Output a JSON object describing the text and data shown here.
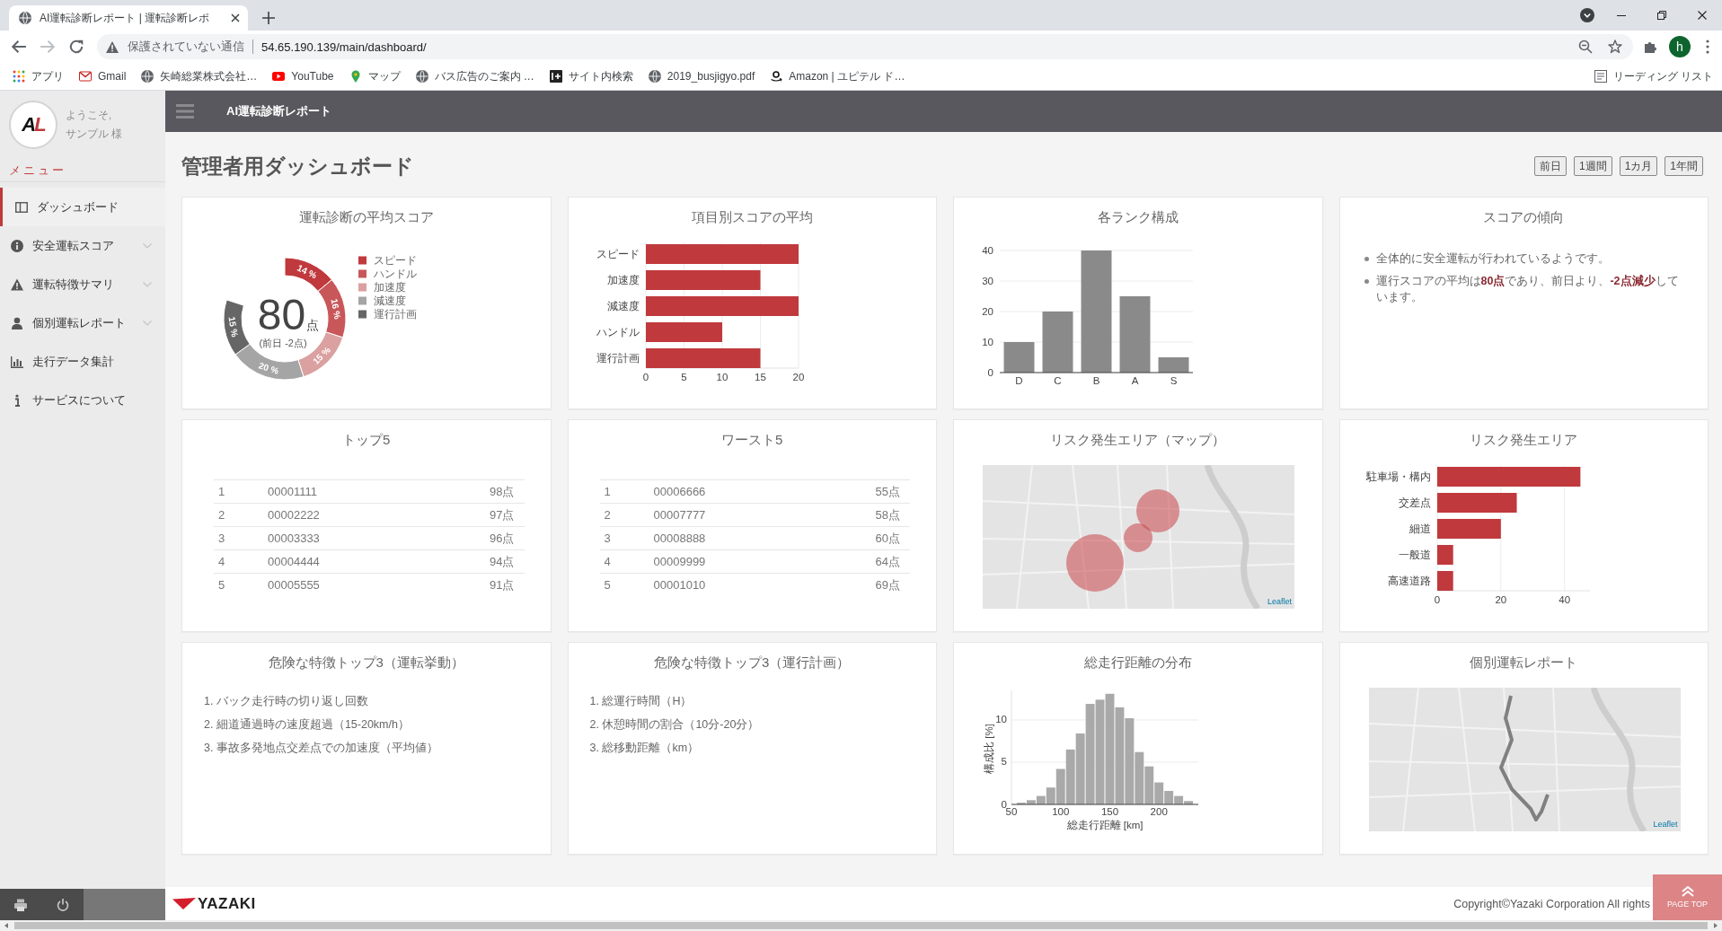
{
  "browser": {
    "tab": {
      "title": "AI運転診断レポート | 運転診断レポ"
    },
    "address": {
      "security": "保護されていない通信",
      "url": "54.65.190.139/main/dashboard/"
    },
    "profile_initial": "h",
    "bookmarks": [
      {
        "kind": "apps",
        "label": "アプリ"
      },
      {
        "kind": "mail",
        "label": "Gmail"
      },
      {
        "kind": "globe",
        "label": "矢崎総業株式会社…"
      },
      {
        "kind": "video",
        "label": "YouTube"
      },
      {
        "kind": "pin",
        "label": "マップ"
      },
      {
        "kind": "globe",
        "label": "バス広告のご案内 …"
      },
      {
        "kind": "site",
        "label": "サイト内検索"
      },
      {
        "kind": "globe",
        "label": "2019_busjigyo.pdf"
      },
      {
        "kind": "shop",
        "label": "Amazon | ユピテル ド…"
      }
    ],
    "reading_list": "リーディング リスト"
  },
  "sidebar": {
    "logo_text": "AL",
    "welcome": "ようこそ,",
    "user": "サンプル 様",
    "menu_heading": "メニュー",
    "items": [
      {
        "kind": "panel",
        "label": "ダッシュボード",
        "selected": true,
        "expandable": false
      },
      {
        "kind": "info",
        "label": "安全運転スコア",
        "selected": false,
        "expandable": true
      },
      {
        "kind": "warning",
        "label": "運転特徴サマリ",
        "selected": false,
        "expandable": true
      },
      {
        "kind": "user",
        "label": "個別運転レポート",
        "selected": false,
        "expandable": true
      },
      {
        "kind": "chart",
        "label": "走行データ集計",
        "selected": false,
        "expandable": false
      },
      {
        "kind": "about",
        "label": "サービスについて",
        "selected": false,
        "expandable": false
      }
    ]
  },
  "header": {
    "title": "AI運転診断レポート"
  },
  "page": {
    "title": "管理者用ダッシュボード",
    "period_buttons": [
      "前日",
      "1週間",
      "1カ月",
      "1年間"
    ]
  },
  "cards": [
    {
      "kind": "chart",
      "title": "運転診断の平均スコア",
      "score": "80",
      "unit": "点",
      "change": "(前日 -2点)",
      "chart_data": {
        "type": "donut",
        "categories": [
          "スピード",
          "ハンドル",
          "加速度",
          "減速度",
          "運行計画"
        ],
        "values": [
          14,
          16,
          15,
          20,
          15
        ],
        "colors": [
          "#c0393d",
          "#c8575a",
          "#dba0a0",
          "#a5a5a5",
          "#666666"
        ],
        "value_labels": [
          "14 %",
          "16 %",
          "15 %",
          "20 %",
          "15 %"
        ],
        "legend": "right"
      }
    },
    {
      "kind": "chart",
      "title": "項目別スコアの平均",
      "chart_data": {
        "type": "bar",
        "orientation": "horizontal",
        "categories": [
          "スピード",
          "加速度",
          "減速度",
          "ハンドル",
          "運行計画"
        ],
        "values": [
          20,
          15,
          20,
          10,
          15
        ],
        "xlim": [
          0,
          20
        ],
        "xticks": [
          0,
          5,
          10,
          15,
          20
        ],
        "grid": true
      }
    },
    {
      "kind": "chart",
      "title": "各ランク構成",
      "chart_data": {
        "type": "bar",
        "orientation": "vertical",
        "categories": [
          "D",
          "C",
          "B",
          "A",
          "S"
        ],
        "values": [
          10,
          20,
          40,
          25,
          5
        ],
        "ylim": [
          0,
          40
        ],
        "yticks": [
          0,
          10,
          20,
          30,
          40
        ],
        "grid": true
      }
    },
    {
      "kind": "notes",
      "title": "スコアの傾向",
      "bullets": [
        "全体的に安全運転が行われているようです。",
        "運行スコアの平均は**80点**であり、前日より、**-2点減少**しています。"
      ]
    },
    {
      "kind": "ranking",
      "title": "トップ5",
      "rows": [
        {
          "rank": "1",
          "id": "00001111",
          "score": "98点"
        },
        {
          "rank": "2",
          "id": "00002222",
          "score": "97点"
        },
        {
          "rank": "3",
          "id": "00003333",
          "score": "96点"
        },
        {
          "rank": "4",
          "id": "00004444",
          "score": "94点"
        },
        {
          "rank": "5",
          "id": "00005555",
          "score": "91点"
        }
      ]
    },
    {
      "kind": "ranking",
      "title": "ワースト5",
      "rows": [
        {
          "rank": "1",
          "id": "00006666",
          "score": "55点"
        },
        {
          "rank": "2",
          "id": "00007777",
          "score": "58点"
        },
        {
          "rank": "3",
          "id": "00008888",
          "score": "60点"
        },
        {
          "rank": "4",
          "id": "00009999",
          "score": "64点"
        },
        {
          "rank": "5",
          "id": "00001010",
          "score": "69点"
        }
      ]
    },
    {
      "kind": "risk_map",
      "title": "リスク発生エリア（マップ）",
      "attribution": "Leaflet"
    },
    {
      "kind": "chart",
      "title": "リスク発生エリア",
      "chart_data": {
        "type": "bar",
        "orientation": "horizontal",
        "categories": [
          "駐車場・構内",
          "交差点",
          "細道",
          "一般道",
          "高速道路"
        ],
        "values": [
          45,
          25,
          20,
          5,
          5
        ],
        "xlim": [
          0,
          48
        ],
        "xticks": [
          0,
          20,
          40
        ],
        "grid": true
      }
    },
    {
      "kind": "numbered_list",
      "title": "危険な特徴トップ3（運転挙動）",
      "items": [
        "1. バック走行時の切り返し回数",
        "2. 細道通過時の速度超過（15-20km/h）",
        "3. 事故多発地点交差点での加速度（平均値）"
      ]
    },
    {
      "kind": "numbered_list",
      "title": "危険な特徴トップ3（運行計画）",
      "items": [
        "1. 総運行時間（H）",
        "2. 休憩時間の割合（10分-20分）",
        "3. 総移動距離（km）"
      ]
    },
    {
      "kind": "histogram",
      "title": "総走行距離の分布",
      "chart_data": {
        "type": "bar",
        "xlabel": "総走行距離 [km]",
        "ylabel": "構成比 [%]",
        "x": [
          60,
          70,
          80,
          90,
          100,
          110,
          120,
          130,
          140,
          150,
          160,
          170,
          180,
          190,
          200,
          210,
          220,
          230
        ],
        "values": [
          0.2,
          0.5,
          1.0,
          2.0,
          4.2,
          6.5,
          8.4,
          11.9,
          12.4,
          13.1,
          11.5,
          10.2,
          6.2,
          4.5,
          2.6,
          1.6,
          1.0,
          0.4
        ],
        "xlim": [
          50,
          240
        ],
        "ylim": [
          0,
          13.5
        ],
        "xticks": [
          50,
          100,
          150,
          200
        ],
        "yticks": [
          0,
          5,
          10
        ],
        "grid": true
      }
    },
    {
      "kind": "route_map",
      "title": "個別運転レポート",
      "attribution": "Leaflet"
    }
  ],
  "footer": {
    "brand": "YAZAKI",
    "copyright": "Copyright©Yazaki Corporation All rights",
    "page_top": "PAGE TOP"
  }
}
